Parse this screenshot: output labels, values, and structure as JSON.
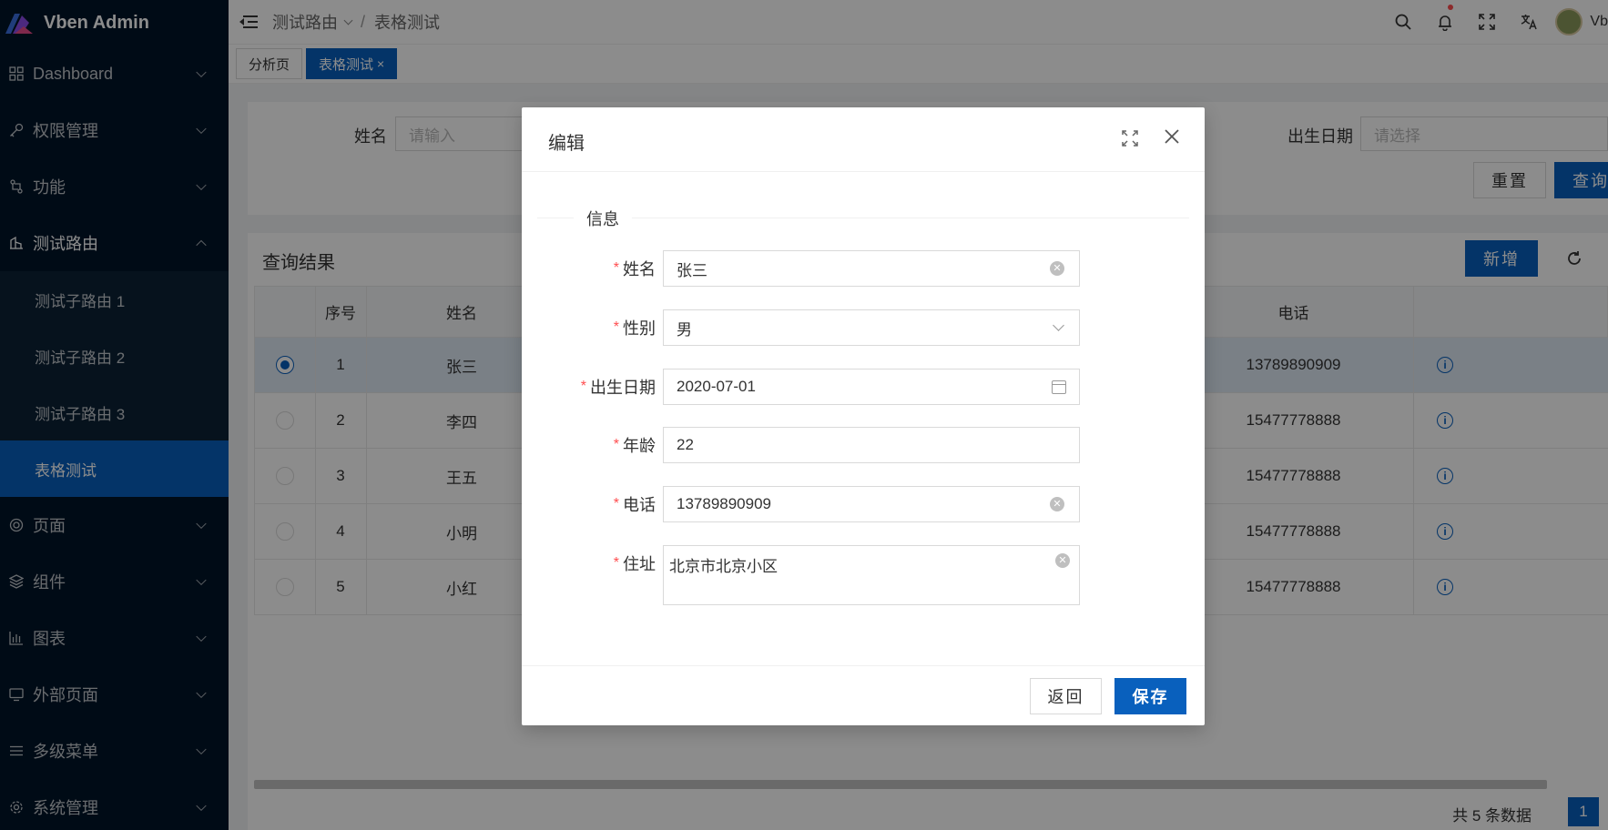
{
  "app": {
    "name": "Vben Admin"
  },
  "sidebar": {
    "items": [
      {
        "label": "Dashboard",
        "icon": "grid-icon"
      },
      {
        "label": "权限管理",
        "icon": "key-icon"
      },
      {
        "label": "功能",
        "icon": "function-icon"
      },
      {
        "label": "测试路由",
        "icon": "route-icon"
      },
      {
        "label": "页面",
        "icon": "page-icon"
      },
      {
        "label": "组件",
        "icon": "layers-icon"
      },
      {
        "label": "图表",
        "icon": "chart-icon"
      },
      {
        "label": "外部页面",
        "icon": "monitor-icon"
      },
      {
        "label": "多级菜单",
        "icon": "menu-icon"
      },
      {
        "label": "系统管理",
        "icon": "settings-icon"
      }
    ],
    "sub_items": [
      "测试子路由 1",
      "测试子路由 2",
      "测试子路由 3",
      "表格测试"
    ],
    "active_sub": "表格测试"
  },
  "header": {
    "breadcrumb": [
      "测试路由",
      "表格测试"
    ],
    "separator": "/",
    "user_initial": "Vb"
  },
  "tabs": [
    {
      "label": "分析页",
      "active": false
    },
    {
      "label": "表格测试",
      "active": true,
      "close": "×"
    }
  ],
  "search": {
    "name_label": "姓名",
    "name_placeholder": "请输入",
    "birth_label": "出生日期",
    "birth_placeholder": "请选择",
    "reset_label": "重置",
    "query_label": "查询"
  },
  "table": {
    "title": "查询结果",
    "add_label": "新增",
    "columns": {
      "index": "序号",
      "name": "姓名",
      "phone": "电话"
    },
    "rows": [
      {
        "index": "1",
        "name": "张三",
        "phone": "13789890909",
        "selected": true
      },
      {
        "index": "2",
        "name": "李四",
        "phone": "15477778888",
        "selected": false
      },
      {
        "index": "3",
        "name": "王五",
        "phone": "15477778888",
        "selected": false
      },
      {
        "index": "4",
        "name": "小明",
        "phone": "15477778888",
        "selected": false
      },
      {
        "index": "5",
        "name": "小红",
        "phone": "15477778888",
        "selected": false
      }
    ],
    "total_text": "共 5 条数据",
    "current_page": "1"
  },
  "modal": {
    "title": "编辑",
    "section": "信息",
    "fields": {
      "name": {
        "label": "姓名",
        "value": "张三"
      },
      "gender": {
        "label": "性别",
        "value": "男"
      },
      "birth": {
        "label": "出生日期",
        "value": "2020-07-01"
      },
      "age": {
        "label": "年龄",
        "value": "22"
      },
      "phone": {
        "label": "电话",
        "value": "13789890909"
      },
      "address": {
        "label": "住址",
        "value": "北京市北京小区"
      }
    },
    "required_mark": "*",
    "back_label": "返回",
    "save_label": "保存"
  },
  "colors": {
    "primary": "#0960bd",
    "sidebar_bg": "#001529",
    "required": "#ff4d4f"
  }
}
